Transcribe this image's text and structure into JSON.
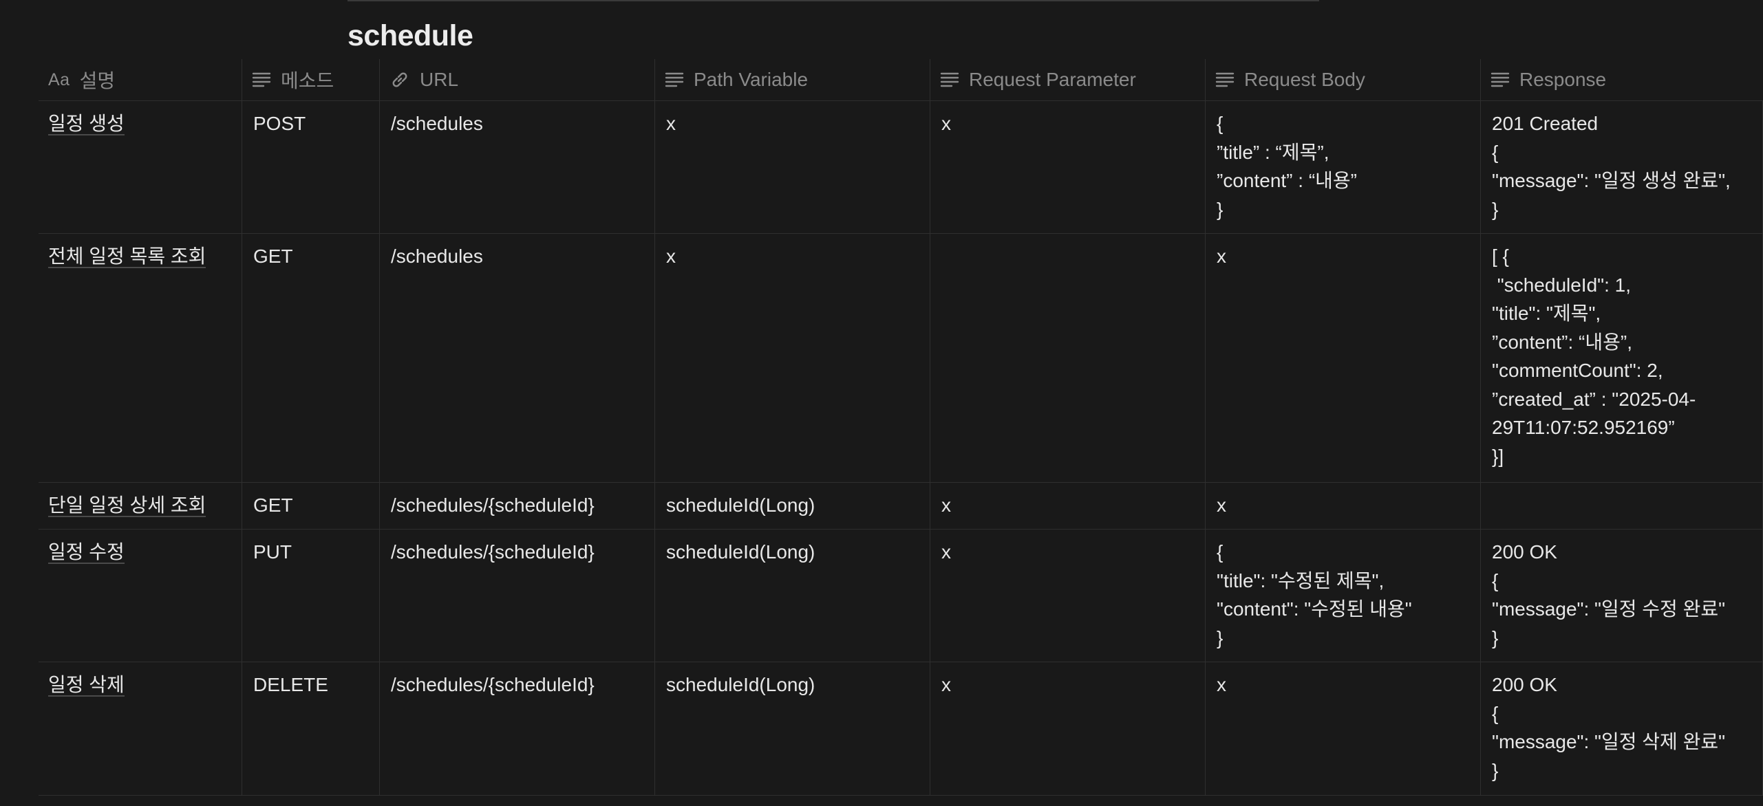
{
  "title": "schedule",
  "columns": {
    "c0": {
      "label": "설명",
      "icon": "Aa"
    },
    "c1": {
      "label": "메소드",
      "icon": "text-lines-icon"
    },
    "c2": {
      "label": "URL",
      "icon": "link-icon"
    },
    "c3": {
      "label": "Path Variable",
      "icon": "text-lines-icon"
    },
    "c4": {
      "label": "Request Parameter",
      "icon": "text-lines-icon"
    },
    "c5": {
      "label": "Request Body",
      "icon": "text-lines-icon"
    },
    "c6": {
      "label": "Response",
      "icon": "text-lines-icon"
    }
  },
  "rows": [
    {
      "c0": "일정 생성",
      "c1": "POST",
      "c2": "/schedules",
      "c3": "x",
      "c4": "x",
      "c5": "{\n”title” : “제목”,\n”content” : “내용”\n}",
      "c6": "201 Created\n{\n\"message\": \"일정 생성 완료\",\n}"
    },
    {
      "c0": "전체 일정 목록 조회",
      "c1": "GET",
      "c2": "/schedules",
      "c3": "x",
      "c4": "",
      "c5": "x",
      "c6": "[ {\n \"scheduleId\": 1,\n\"title\": \"제목\",\n”content”: “내용”,\n\"commentCount\": 2,\n”created_at” : \"2025-04-\n29T11:07:52.952169”\n}]"
    },
    {
      "c0": "단일 일정 상세 조회",
      "c1": "GET",
      "c2": "/schedules/{scheduleId}",
      "c3": "scheduleId(Long)",
      "c4": "x",
      "c5": "x",
      "c6": ""
    },
    {
      "c0": "일정 수정",
      "c1": "PUT",
      "c2": "/schedules/{scheduleId}",
      "c3": "scheduleId(Long)",
      "c4": "x",
      "c5": "{\n\"title\": \"수정된 제목\",\n\"content\": \"수정된 내용\"\n}",
      "c6": "200 OK\n{\n\"message\": \"일정 수정 완료\"\n}"
    },
    {
      "c0": "일정 삭제",
      "c1": "DELETE",
      "c2": "/schedules/{scheduleId}",
      "c3": "scheduleId(Long)",
      "c4": "x",
      "c5": "x",
      "c6": "200 OK\n{\n\"message\": \"일정 삭제 완료\"\n}"
    }
  ]
}
